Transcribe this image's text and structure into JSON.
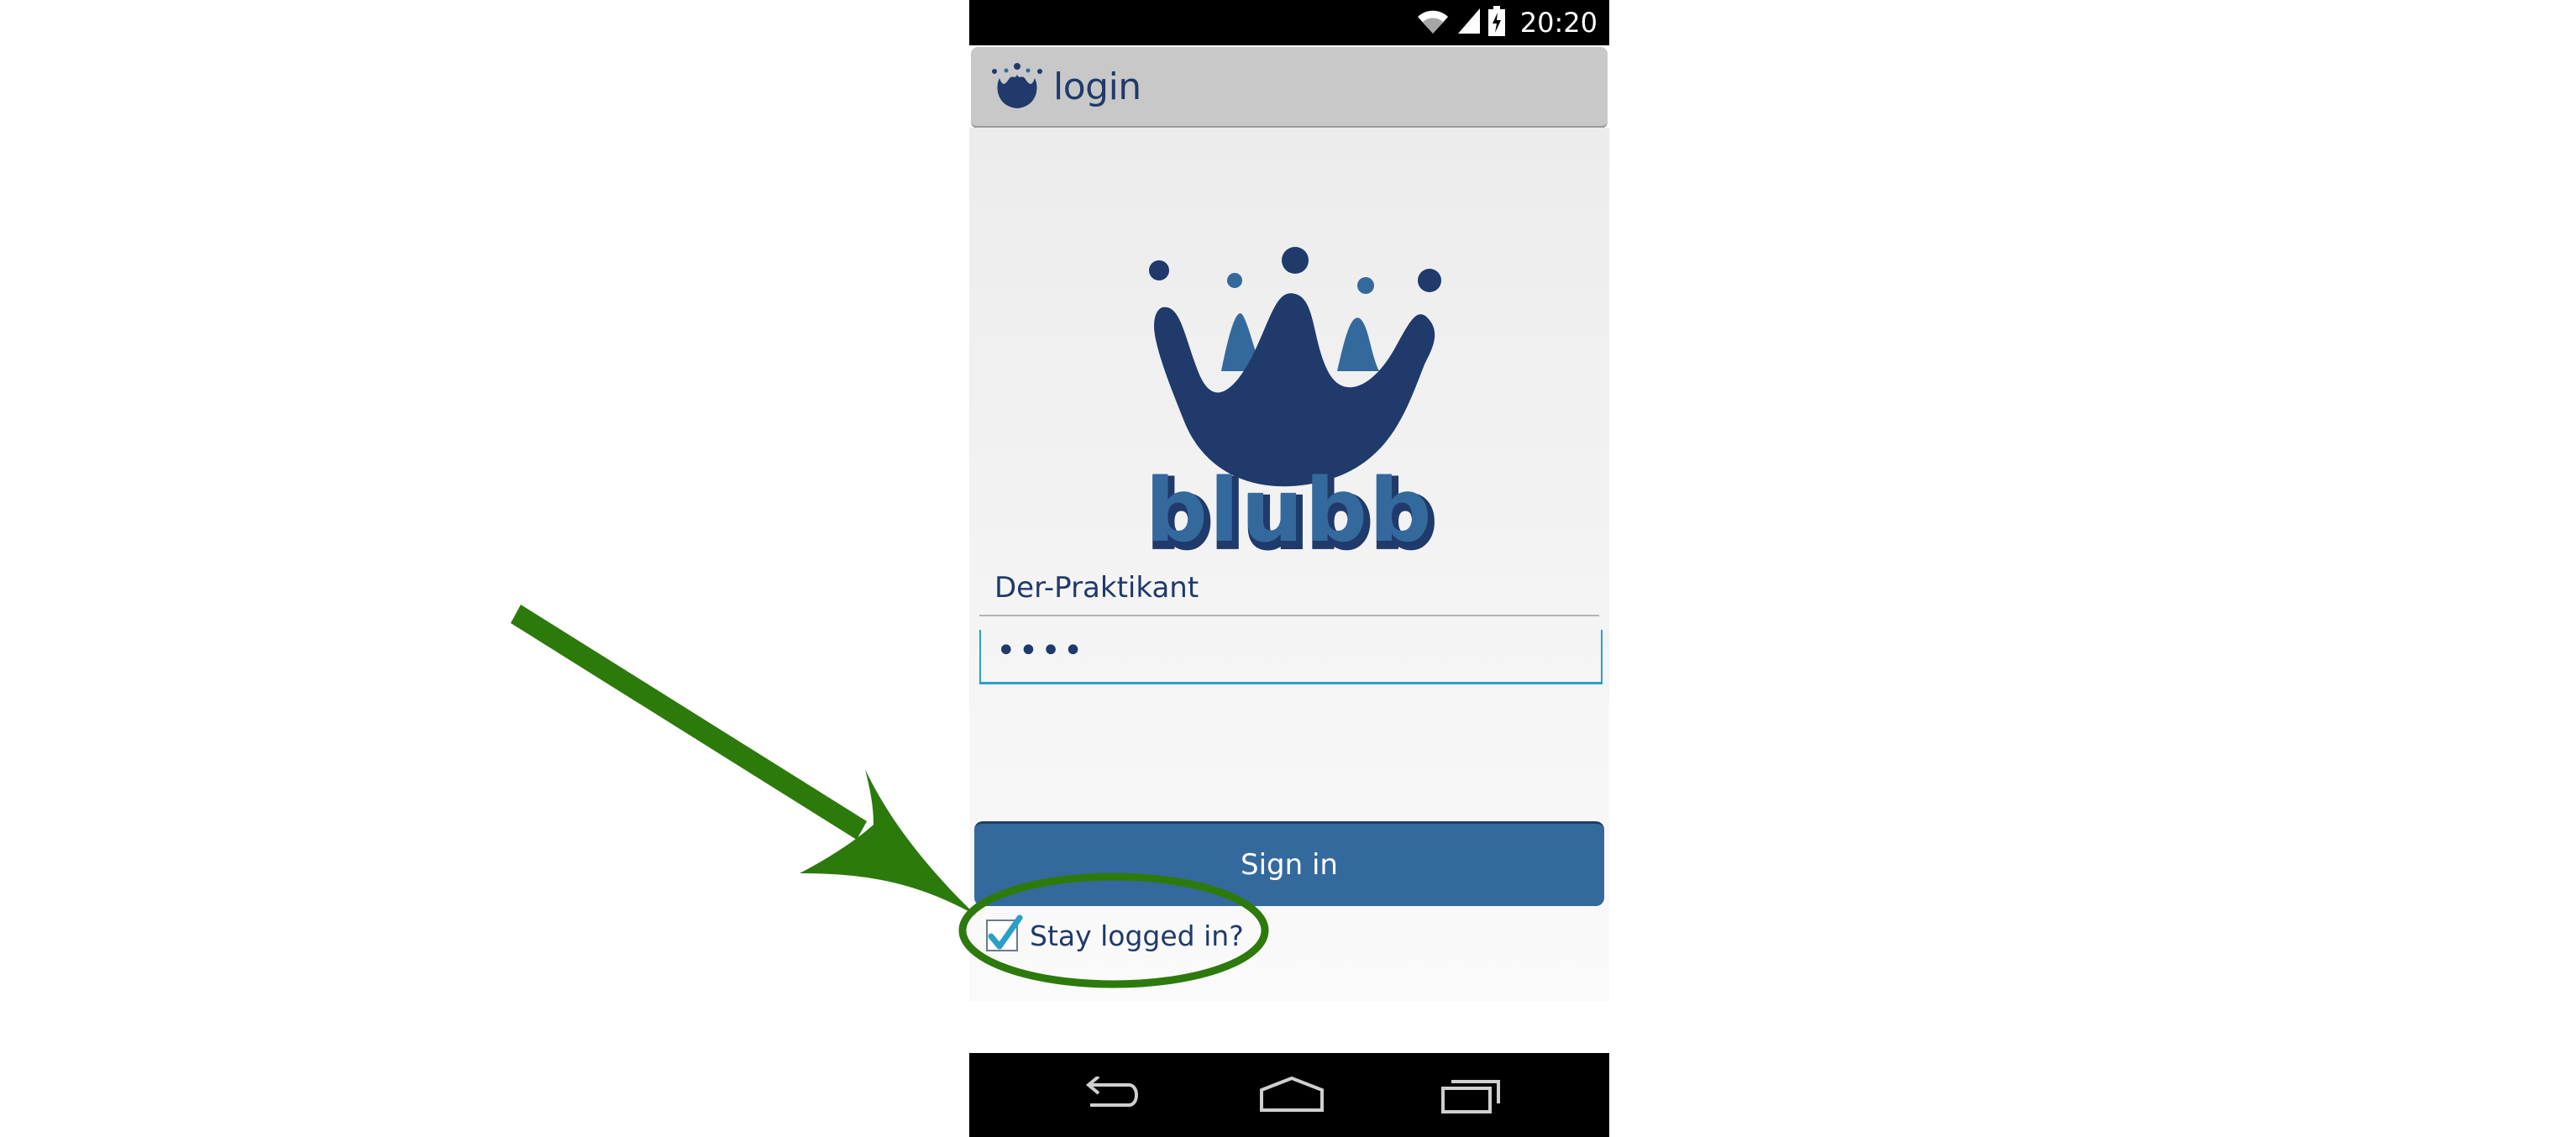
{
  "status_bar": {
    "time": "20:20",
    "icons": [
      "wifi-icon",
      "signal-icon",
      "battery-icon"
    ]
  },
  "action_bar": {
    "title": "login",
    "icon": "crown-logo-icon"
  },
  "logo": {
    "wordmark": "blubb"
  },
  "form": {
    "username_value": "Der-Praktikant",
    "password_value": "••••",
    "sign_in_label": "Sign in",
    "stay_logged_in_label": "Stay logged in?",
    "stay_logged_in_checked": true
  },
  "nav_bar": {
    "icons": [
      "back-icon",
      "home-icon",
      "recent-apps-icon"
    ]
  },
  "colors": {
    "brand_dark": "#1f3a6b",
    "brand_light": "#34699e",
    "annotation_green": "#2d7a0c",
    "focus_accent": "#2aa0c8"
  }
}
